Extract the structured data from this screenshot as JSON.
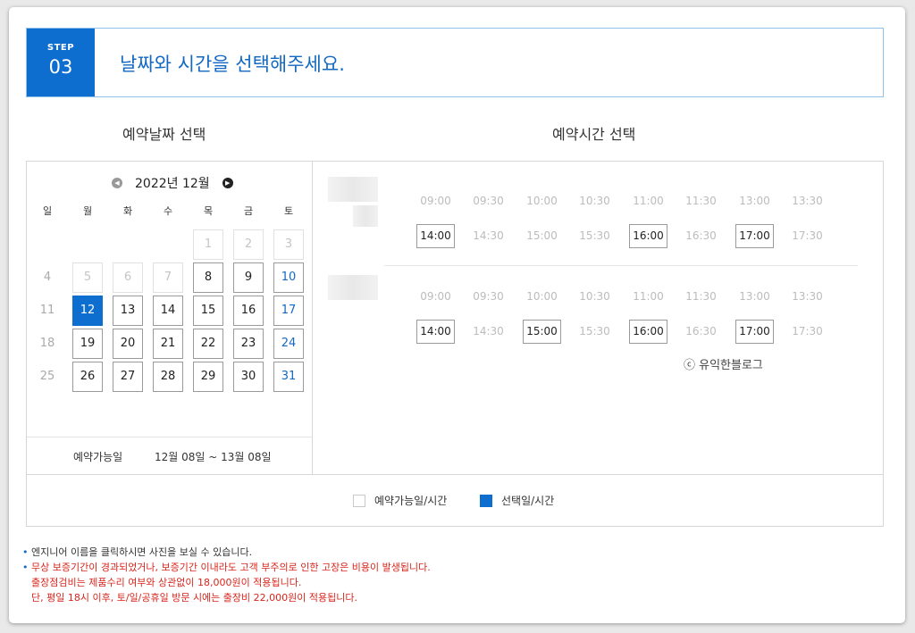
{
  "step": {
    "label": "STEP",
    "number": "03",
    "title": "날짜와 시간을 선택해주세요."
  },
  "sections": {
    "date_title": "예약날짜 선택",
    "time_title": "예약시간 선택"
  },
  "calendar": {
    "month_label": "2022년 12월",
    "weekdays": [
      "일",
      "월",
      "화",
      "수",
      "목",
      "금",
      "토"
    ],
    "weeks": [
      [
        null,
        null,
        null,
        null,
        {
          "d": "1",
          "s": "disabled"
        },
        {
          "d": "2",
          "s": "disabled"
        },
        {
          "d": "3",
          "s": "disabled"
        }
      ],
      [
        {
          "d": "4",
          "s": "plain"
        },
        {
          "d": "5",
          "s": "disabled"
        },
        {
          "d": "6",
          "s": "disabled"
        },
        {
          "d": "7",
          "s": "disabled"
        },
        {
          "d": "8",
          "s": "avail"
        },
        {
          "d": "9",
          "s": "avail"
        },
        {
          "d": "10",
          "s": "avail-sat"
        }
      ],
      [
        {
          "d": "11",
          "s": "plain"
        },
        {
          "d": "12",
          "s": "selected"
        },
        {
          "d": "13",
          "s": "avail"
        },
        {
          "d": "14",
          "s": "avail"
        },
        {
          "d": "15",
          "s": "avail"
        },
        {
          "d": "16",
          "s": "avail"
        },
        {
          "d": "17",
          "s": "avail-sat"
        }
      ],
      [
        {
          "d": "18",
          "s": "plain"
        },
        {
          "d": "19",
          "s": "avail"
        },
        {
          "d": "20",
          "s": "avail"
        },
        {
          "d": "21",
          "s": "avail"
        },
        {
          "d": "22",
          "s": "avail"
        },
        {
          "d": "23",
          "s": "avail"
        },
        {
          "d": "24",
          "s": "avail-sat"
        }
      ],
      [
        {
          "d": "25",
          "s": "plain"
        },
        {
          "d": "26",
          "s": "avail"
        },
        {
          "d": "27",
          "s": "avail"
        },
        {
          "d": "28",
          "s": "avail"
        },
        {
          "d": "29",
          "s": "avail"
        },
        {
          "d": "30",
          "s": "avail"
        },
        {
          "d": "31",
          "s": "avail-sat"
        }
      ]
    ],
    "available_label": "예약가능일",
    "available_range": "12월 08일 ~ 13월 08일"
  },
  "engineers": [
    {
      "slots": [
        {
          "time": "09:00",
          "available": false
        },
        {
          "time": "09:30",
          "available": false
        },
        {
          "time": "10:00",
          "available": false
        },
        {
          "time": "10:30",
          "available": false
        },
        {
          "time": "11:00",
          "available": false
        },
        {
          "time": "11:30",
          "available": false
        },
        {
          "time": "13:00",
          "available": false
        },
        {
          "time": "13:30",
          "available": false
        },
        {
          "time": "14:00",
          "available": true
        },
        {
          "time": "14:30",
          "available": false
        },
        {
          "time": "15:00",
          "available": false
        },
        {
          "time": "15:30",
          "available": false
        },
        {
          "time": "16:00",
          "available": true
        },
        {
          "time": "16:30",
          "available": false
        },
        {
          "time": "17:00",
          "available": true
        },
        {
          "time": "17:30",
          "available": false
        }
      ]
    },
    {
      "slots": [
        {
          "time": "09:00",
          "available": false
        },
        {
          "time": "09:30",
          "available": false
        },
        {
          "time": "10:00",
          "available": false
        },
        {
          "time": "10:30",
          "available": false
        },
        {
          "time": "11:00",
          "available": false
        },
        {
          "time": "11:30",
          "available": false
        },
        {
          "time": "13:00",
          "available": false
        },
        {
          "time": "13:30",
          "available": false
        },
        {
          "time": "14:00",
          "available": true
        },
        {
          "time": "14:30",
          "available": false
        },
        {
          "time": "15:00",
          "available": true
        },
        {
          "time": "15:30",
          "available": false
        },
        {
          "time": "16:00",
          "available": true
        },
        {
          "time": "16:30",
          "available": false
        },
        {
          "time": "17:00",
          "available": true
        },
        {
          "time": "17:30",
          "available": false
        }
      ]
    }
  ],
  "watermark": "ⓒ 유익한블로그",
  "legend": {
    "available": "예약가능일/시간",
    "selected": "선택일/시간"
  },
  "notes": [
    {
      "text": "엔지니어 이름을 클릭하시면 사진을 보실 수 있습니다.",
      "color": "blue"
    },
    {
      "text": "무상 보증기간이 경과되었거나, 보증기간 이내라도 고객 부주의로 인한 고장은 비용이 발생됩니다.",
      "color": "red"
    },
    {
      "text": "출장점검비는 제품수리 여부와 상관없이 18,000원이 적용됩니다.",
      "color": "red",
      "indent": true
    },
    {
      "text": "단, 평일 18시 이후, 토/일/공휴일 방문 시에는 출장비 22,000원이 적용됩니다.",
      "color": "red",
      "indent": true
    }
  ],
  "colors": {
    "primary": "#0d6ecf",
    "step_title": "#1369c2",
    "note_red": "#d8261c"
  }
}
